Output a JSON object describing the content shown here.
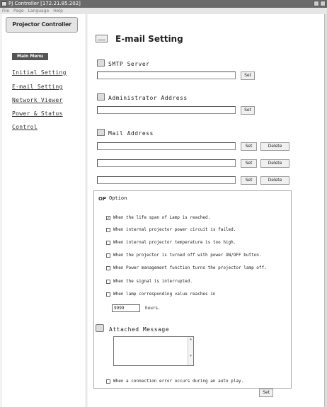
{
  "window": {
    "title": "PJ Controller [172.21.85.202]"
  },
  "menubar": {
    "items": [
      "File",
      "Page",
      "Language",
      "Help"
    ]
  },
  "sidebar": {
    "logo_text": "Projector Controller",
    "main_menu_label": "Main Menu",
    "links": [
      {
        "label": "Initial Setting"
      },
      {
        "label": "E-mail Setting"
      },
      {
        "label": "Network Viewer"
      },
      {
        "label": "Power & Status"
      },
      {
        "label": "Control"
      }
    ]
  },
  "page": {
    "title": "E-mail Setting"
  },
  "smtp": {
    "label": "SMTP Server",
    "value": "",
    "set_label": "Set"
  },
  "admin": {
    "label": "Administrator Address",
    "value": "",
    "set_label": "Set"
  },
  "mail": {
    "label": "Mail Address",
    "rows": [
      {
        "value": "",
        "set_label": "Set",
        "delete_label": "Delete"
      },
      {
        "value": "",
        "set_label": "Set",
        "delete_label": "Delete"
      },
      {
        "value": "",
        "set_label": "Set",
        "delete_label": "Delete"
      }
    ]
  },
  "option": {
    "icon_text": "OP",
    "title": "Option",
    "items": [
      {
        "label": "When the life span of Lamp is reached.",
        "checked": true
      },
      {
        "label": "When internal projector power circuit is failed.",
        "checked": false
      },
      {
        "label": "When internal projector temperature is too high.",
        "checked": false
      },
      {
        "label": "When the projector is turned off with power ON/OFF button.",
        "checked": false
      },
      {
        "label": "When Power management function turns the projector lamp off.",
        "checked": false
      },
      {
        "label": "When the signal is interrupted.",
        "checked": false
      },
      {
        "label": "When lamp corresponding value reaches in",
        "checked": false
      }
    ],
    "hours_value": "9999",
    "hours_label": "hours."
  },
  "message": {
    "label": "Attached Message",
    "value": ""
  },
  "error_option": {
    "label": "When a connection error occurs during an auto play.",
    "checked": false
  },
  "footer": {
    "set_label": "Set"
  }
}
